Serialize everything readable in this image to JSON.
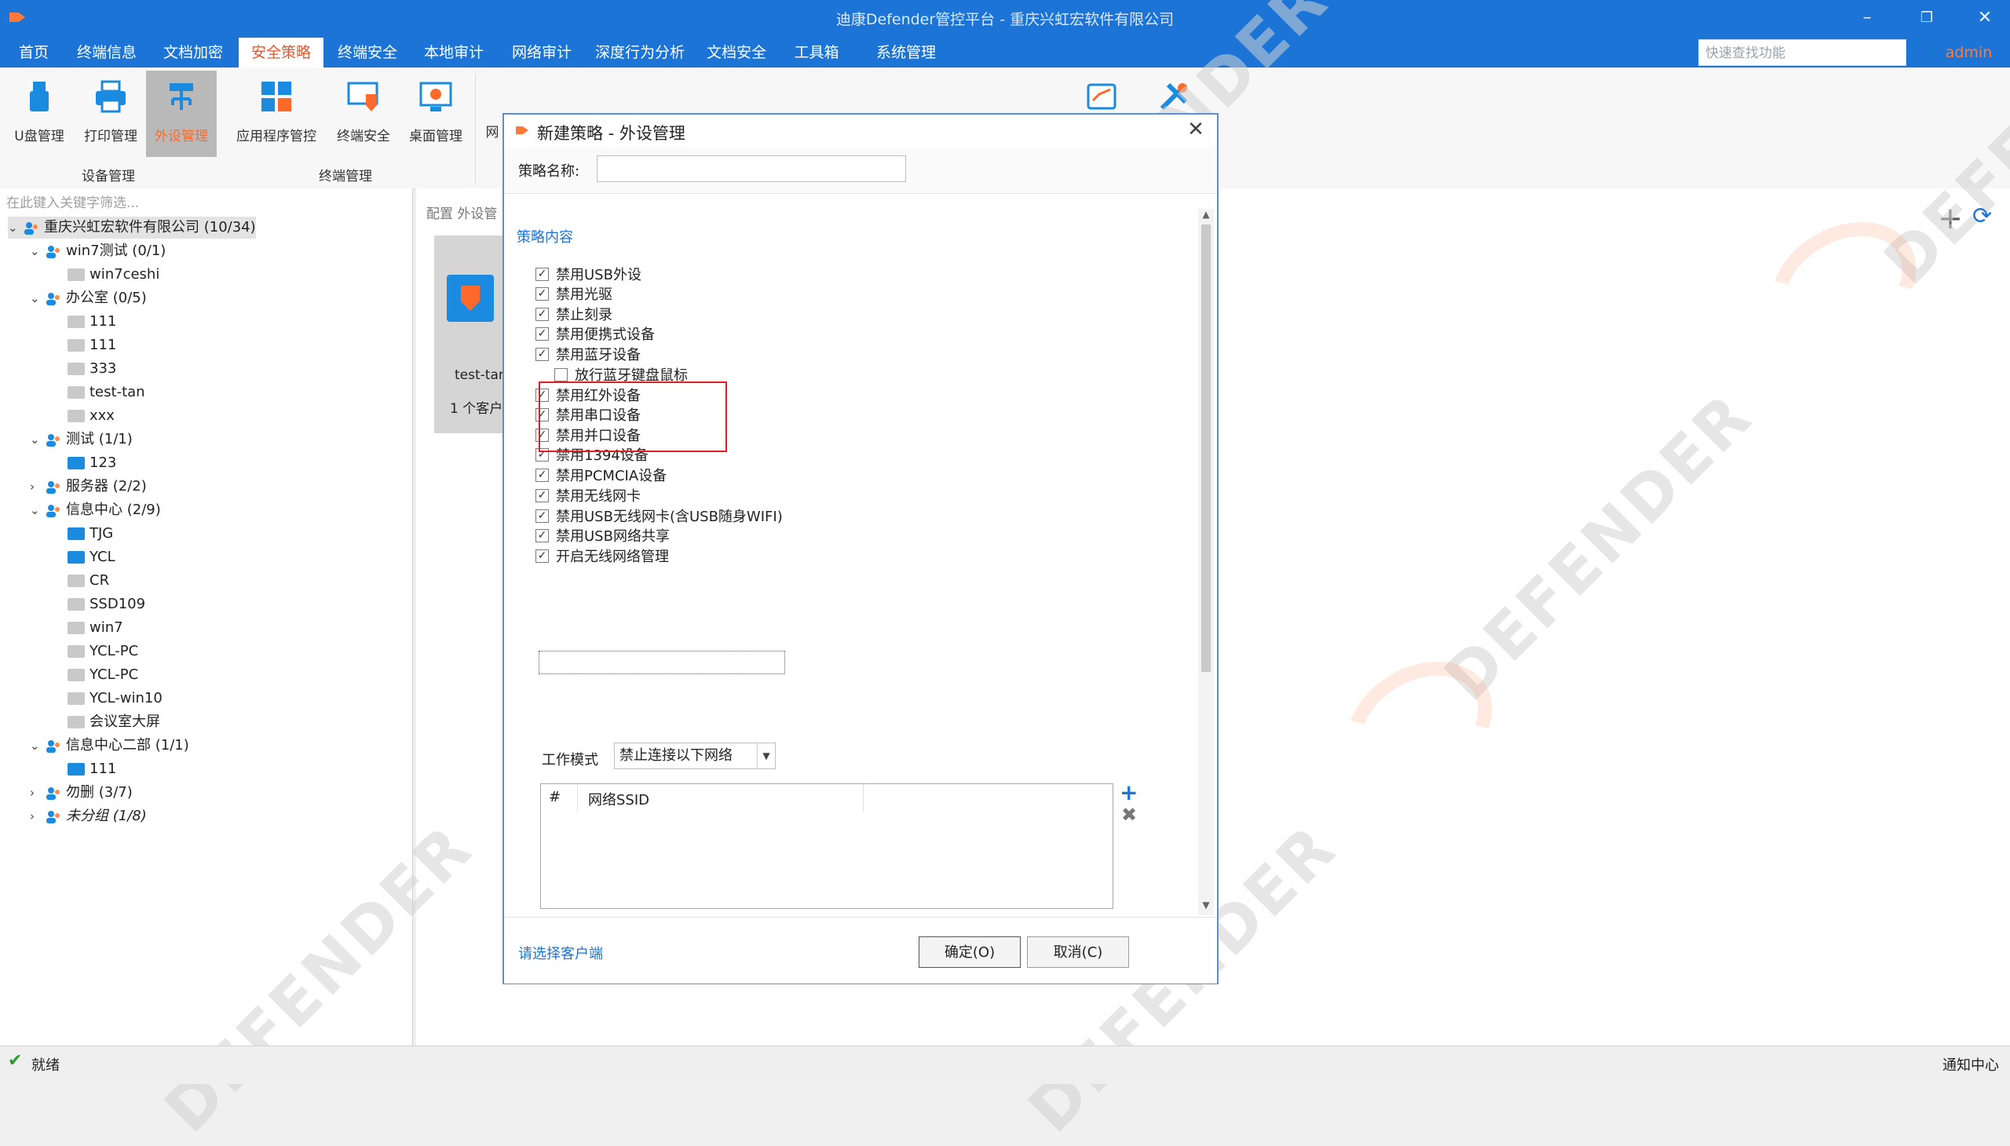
{
  "window": {
    "title": "迪康Defender管控平台 - 重庆兴虹宏软件有限公司"
  },
  "menu": {
    "items": [
      "首页",
      "终端信息",
      "文档加密",
      "安全策略",
      "终端安全",
      "本地审计",
      "网络审计",
      "深度行为分析",
      "文档安全",
      "工具箱",
      "系统管理"
    ],
    "active_index": 3,
    "search_placeholder": "快速查找功能",
    "user": "admin"
  },
  "ribbon": {
    "buttons": [
      {
        "label": "U盘管理",
        "icon": "usb-drive-icon"
      },
      {
        "label": "打印管理",
        "icon": "printer-icon"
      },
      {
        "label": "外设管理",
        "icon": "usb-hub-icon"
      },
      {
        "label": "应用程序管控",
        "icon": "app-grid-icon"
      },
      {
        "label": "终端安全",
        "icon": "monitor-shield-icon"
      },
      {
        "label": "桌面管理",
        "icon": "desktop-icon"
      },
      {
        "label": "网",
        "icon": "network-icon"
      }
    ],
    "groups": {
      "device": "设备管理",
      "terminal": "终端管理"
    }
  },
  "tree": {
    "filter_placeholder": "在此键入关键字筛选...",
    "nodes": [
      {
        "label": "重庆兴虹宏软件有限公司 (10/34)",
        "type": "group"
      },
      {
        "label": "win7测试 (0/1)",
        "type": "group"
      },
      {
        "label": "win7ceshi",
        "type": "pc-off"
      },
      {
        "label": "办公室 (0/5)",
        "type": "group"
      },
      {
        "label": "111",
        "type": "pc-off"
      },
      {
        "label": "111",
        "type": "pc-off"
      },
      {
        "label": "333",
        "type": "pc-off"
      },
      {
        "label": "test-tan",
        "type": "pc-off"
      },
      {
        "label": "xxx",
        "type": "pc-off"
      },
      {
        "label": "测试 (1/1)",
        "type": "group"
      },
      {
        "label": "123",
        "type": "pc-on"
      },
      {
        "label": "服务器 (2/2)",
        "type": "group"
      },
      {
        "label": "信息中心 (2/9)",
        "type": "group"
      },
      {
        "label": "TJG",
        "type": "pc-on"
      },
      {
        "label": "YCL",
        "type": "pc-on"
      },
      {
        "label": "CR",
        "type": "pc-off"
      },
      {
        "label": "SSD109",
        "type": "pc-off"
      },
      {
        "label": "win7",
        "type": "pc-off"
      },
      {
        "label": "YCL-PC",
        "type": "pc-off"
      },
      {
        "label": "YCL-PC",
        "type": "pc-off"
      },
      {
        "label": "YCL-win10",
        "type": "pc-off"
      },
      {
        "label": "会议室大屏",
        "type": "pc-off"
      },
      {
        "label": "信息中心二部 (1/1)",
        "type": "group"
      },
      {
        "label": "111",
        "type": "pc-on"
      },
      {
        "label": "勿删 (3/7)",
        "type": "group"
      },
      {
        "label": "未分组 (1/8)",
        "type": "group"
      }
    ]
  },
  "content": {
    "breadcrumb": "配置 外设管",
    "card_name": "test-tan",
    "card_count": "1 个客户"
  },
  "dialog": {
    "title": "新建策略 - 外设管理",
    "name_label": "策略名称:",
    "name_value": "",
    "section_label": "策略内容",
    "options": [
      {
        "label": "禁用USB外设",
        "checked": true
      },
      {
        "label": "禁用光驱",
        "checked": true
      },
      {
        "label": "禁止刻录",
        "checked": true
      },
      {
        "label": "禁用便携式设备",
        "checked": true
      },
      {
        "label": "禁用蓝牙设备",
        "checked": true
      },
      {
        "label": "放行蓝牙键盘鼠标",
        "checked": false
      },
      {
        "label": "禁用红外设备",
        "checked": true
      },
      {
        "label": "禁用串口设备",
        "checked": true
      },
      {
        "label": "禁用并口设备",
        "checked": true
      },
      {
        "label": "禁用1394设备",
        "checked": true
      },
      {
        "label": "禁用PCMCIA设备",
        "checked": true
      },
      {
        "label": "禁用无线网卡",
        "checked": true
      },
      {
        "label": "禁用USB无线网卡(含USB随身WIFI)",
        "checked": true
      },
      {
        "label": "禁用USB网络共享",
        "checked": true
      },
      {
        "label": "开启无线网络管理",
        "checked": true
      }
    ],
    "work_mode_label": "工作模式",
    "work_mode_value": "禁止连接以下网络",
    "ssid_table": {
      "col_index": "#",
      "col_ssid": "网络SSID"
    },
    "select_clients": "请选择客户端",
    "ok_label": "确定(O)",
    "cancel_label": "取消(C)"
  },
  "status": {
    "text": "就绪",
    "notify": "通知中心"
  },
  "watermark": "DEFENDER",
  "colors": {
    "titlebar": "#1b74d6",
    "accent": "#ff6a2a",
    "highlight": "#e02020"
  }
}
